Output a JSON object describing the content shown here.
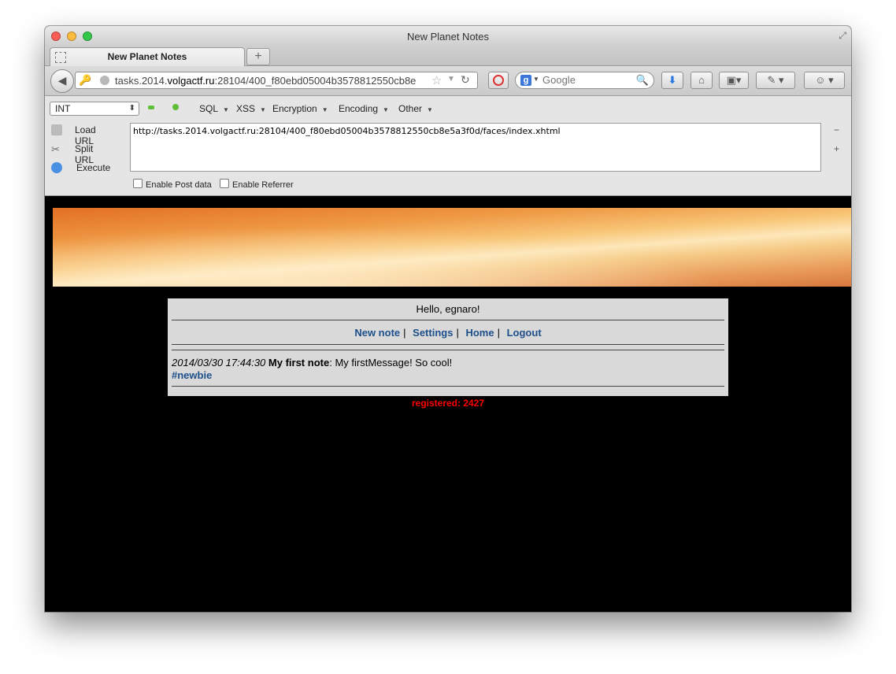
{
  "window": {
    "title": "New Planet Notes"
  },
  "tabs": [
    {
      "label": "New Planet Notes"
    }
  ],
  "tabbar": {
    "new_tab": "+"
  },
  "navbar": {
    "url_host_prefix": "tasks.2014.",
    "url_domain": "volgactf.ru",
    "url_path": ":28104/400_f80ebd05004b3578812550cb8e",
    "search_placeholder": "Google",
    "search_engine": "g"
  },
  "hackbar": {
    "select_value": "INT",
    "menus": [
      "SQL",
      "XSS",
      "Encryption",
      "Encoding",
      "Other"
    ],
    "load_url": "Load URL",
    "split_url": "Split URL",
    "execute": "Execute",
    "url_value": "http://tasks.2014.volgactf.ru:28104/400_f80ebd05004b3578812550cb8e5a3f0d/faces/index.xhtml",
    "enable_post": "Enable Post data",
    "enable_referrer": "Enable Referrer",
    "minus": "−",
    "plus": "+"
  },
  "page": {
    "greeting": "Hello, egnaro!",
    "nav_links": [
      "New note",
      "Settings",
      "Home",
      "Logout"
    ],
    "separator": "|",
    "note": {
      "date": "2014/03/30 17:44:30",
      "title": "My first note",
      "colon": ":",
      "message": " My firstMessage! So cool!",
      "tag": "#newbie"
    },
    "registered": "registered: 2427"
  },
  "colors": {
    "link": "#1d4f8a",
    "registered": "#ff0000",
    "panel_bg": "#d9d9d9"
  }
}
